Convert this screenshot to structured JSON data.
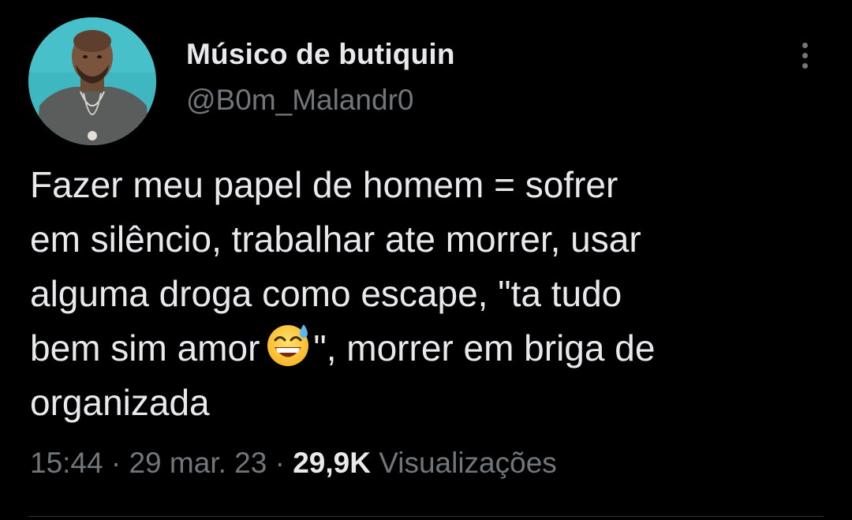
{
  "author": {
    "display_name": "Músico de butiquin",
    "handle": "@B0m_Malandr0",
    "avatar_icon": "profile-photo"
  },
  "more_icon": "more-vertical-icon",
  "tweet": {
    "lines": [
      "Fazer meu papel de homem = sofrer",
      "em silêncio, trabalhar ate morrer, usar",
      "alguma droga como escape, \"ta tudo",
      "bem sim amor",
      "\", morrer em briga de",
      "organizada"
    ],
    "emoji": "grinning-face-with-sweat-emoji"
  },
  "meta": {
    "time": "15:44",
    "separator": "·",
    "date": "29 mar. 23",
    "views_count": "29,9K",
    "views_label": "Visualizações"
  },
  "colors": {
    "background": "#000000",
    "primary_text": "#e7e9ea",
    "secondary_text": "#71767b",
    "divider": "#2f3336"
  }
}
